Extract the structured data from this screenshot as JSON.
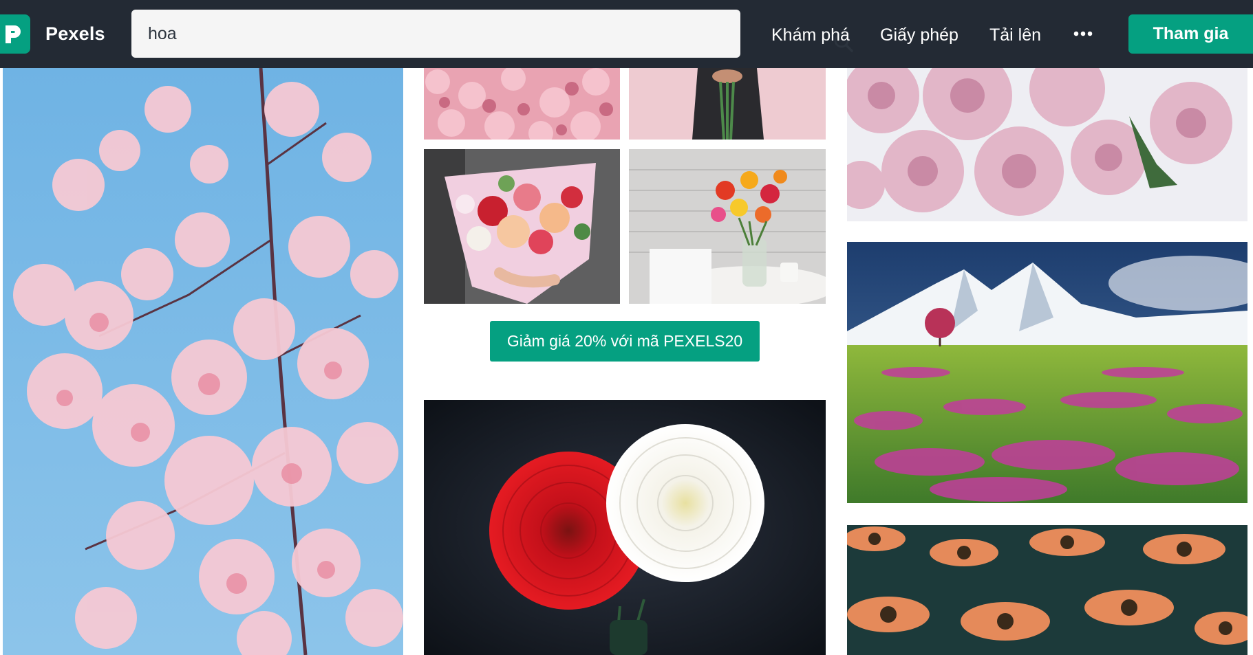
{
  "brand": {
    "name": "Pexels",
    "icon": "pexels-logo-icon",
    "accent_color": "#05a081"
  },
  "navbar": {
    "background_color": "#232a34"
  },
  "search": {
    "value": "hoa",
    "icon": "search-icon"
  },
  "nav": {
    "explore": "Khám phá",
    "license": "Giấy phép",
    "upload": "Tải lên",
    "more_icon": "more-dots-icon",
    "join": "Tham gia"
  },
  "promo": {
    "label": "Giảm giá 20% với mã PEXELS20"
  },
  "photos": [
    {
      "subject": "cherry-blossom"
    },
    {
      "subject": "pink-flower-wall"
    },
    {
      "subject": "woman-holding-flowers"
    },
    {
      "subject": "flower-bouquet"
    },
    {
      "subject": "flower-vase-on-table"
    },
    {
      "subject": "red-and-white-dahlias"
    },
    {
      "subject": "pink-peonies"
    },
    {
      "subject": "mountain-flower-field"
    },
    {
      "subject": "orange-daisies"
    }
  ]
}
